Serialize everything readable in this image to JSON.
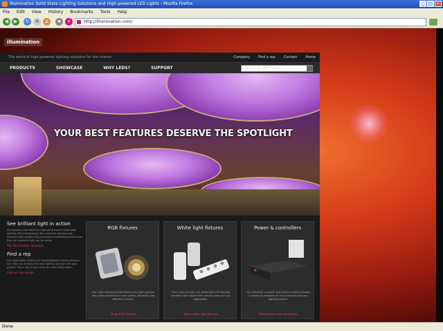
{
  "browser": {
    "title": "Illumination Solid State Lighting Solutions and High-powered LED Lights - Mozilla Firefox",
    "menu": [
      "File",
      "Edit",
      "View",
      "History",
      "Bookmarks",
      "Tools",
      "Help"
    ],
    "url": "http://illumination.com/",
    "status": "Done"
  },
  "site": {
    "logo": "illumination",
    "tagline": "The world of high-powered lighting solutions for the interior",
    "top_links": [
      "Company",
      "Find a rep",
      "Contact",
      "Home"
    ],
    "nav": [
      "PRODUCTS",
      "SHOWCASE",
      "WHY LEDS?",
      "SUPPORT"
    ],
    "search_placeholder": "Search our site",
    "hero_headline": "YOUR BEST FEATURES DESERVE THE SPOTLIGHT",
    "intro": {
      "heading": "See brilliant light in action",
      "body": "Illumination manufactures high-performance solid state lighting (SSL) technology. See customer testimonials, industry case studies and permanent installations that show how our products light up the world.",
      "link": "The illumination showcase",
      "rep_heading": "Find a rep",
      "rep_body": "Our world-wide network of knowledgeable representatives can help you develop the best lighting solutions for your project. Find a rep in your area for more information.",
      "rep_link": "Visit our rep locator"
    },
    "cards": [
      {
        "title": "RGB fixtures",
        "desc": "Our color-changing RGB fixtures and light engines set a new standard for color quality, flexibility and efficient controls.",
        "link": "Show RGB fixtures"
      },
      {
        "title": "White light fixtures",
        "desc": "From warm to cool, our white light LED fixtures combine high output with precise optics for any application.",
        "link": "Show white light fixtures"
      },
      {
        "title": "Power & controllers",
        "desc": "Our selection of power and control systems makes it simple to integrate all of our fixtures into any lighting project.",
        "link": "Show power and controllers"
      }
    ]
  }
}
